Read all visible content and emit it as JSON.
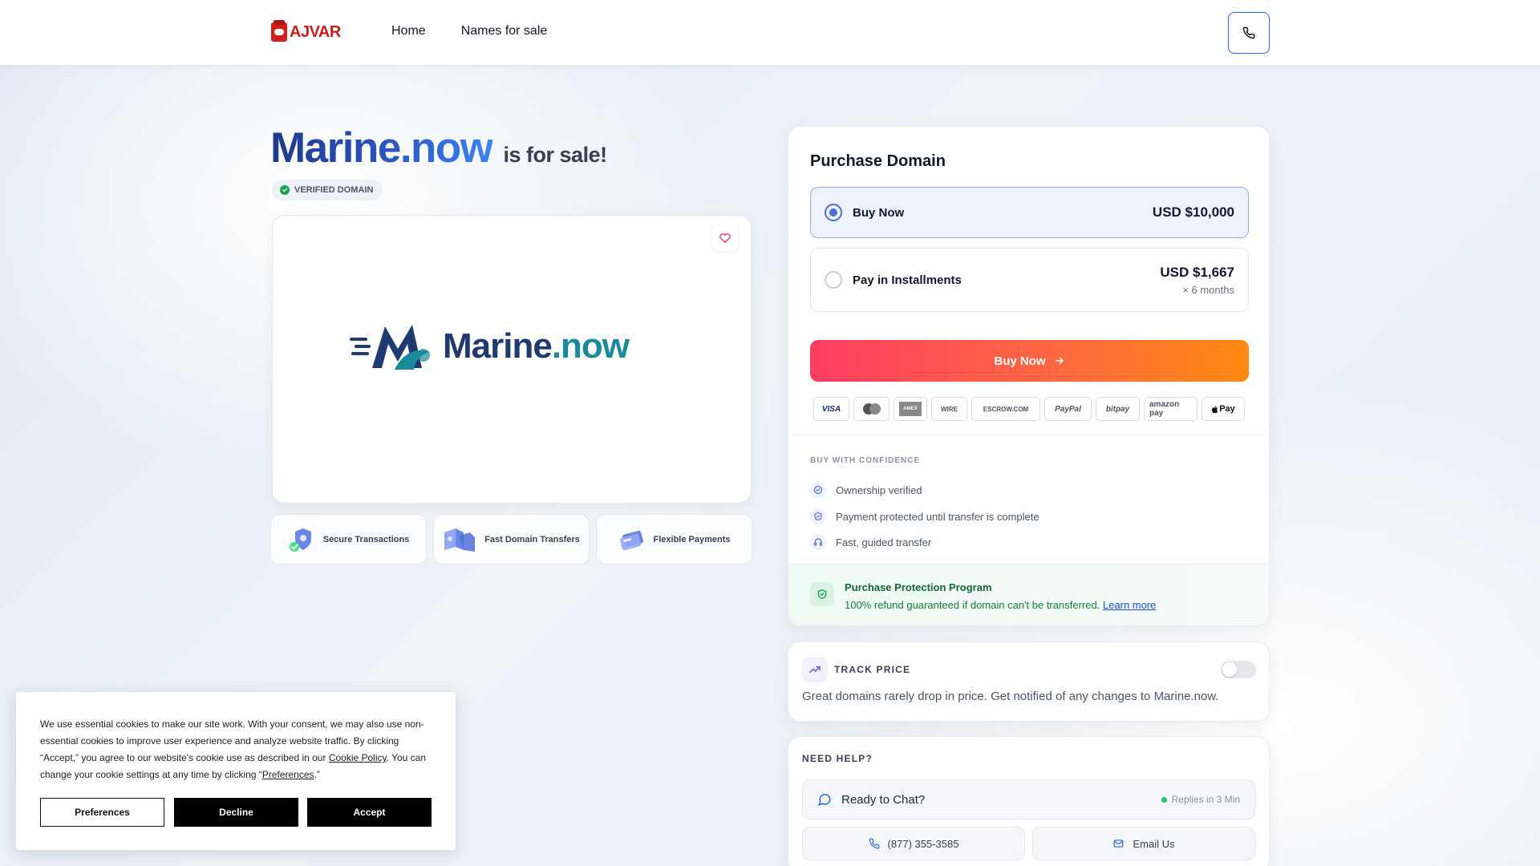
{
  "header": {
    "logo_text": "AJVAR",
    "nav": [
      "Home",
      "Names for sale"
    ]
  },
  "hero": {
    "domain_base": "Marine",
    "domain_tld": ".now",
    "for_sale": "is for sale!",
    "verified": "VERIFIED DOMAIN",
    "brand_main": "Marine",
    "brand_tld": ".now"
  },
  "features": [
    "Secure Transactions",
    "Fast Domain Transfers",
    "Flexible Payments"
  ],
  "purchase": {
    "title": "Purchase Domain",
    "buy_now_label": "Buy Now",
    "buy_now_price": "USD $10,000",
    "installments_label": "Pay in Installments",
    "installments_price": "USD $1,667",
    "installments_term": "× 6 months",
    "buy_button": "Buy Now",
    "payment_methods": [
      "VISA",
      "mastercard",
      "AMEX",
      "WIRE",
      "ESCROW.COM",
      "PayPal",
      "bitpay",
      "amazon pay",
      "Pay"
    ],
    "confidence_title": "BUY WITH CONFIDENCE",
    "confidence_items": [
      "Ownership verified",
      "Payment protected until transfer is complete",
      "Fast, guided transfer"
    ],
    "protection_title": "Purchase Protection Program",
    "protection_text": "100% refund guaranteed if domain can't be transferred.",
    "protection_link": "Learn more"
  },
  "track": {
    "title": "TRACK PRICE",
    "text": "Great domains rarely drop in price. Get notified of any changes to Marine.now.",
    "enabled": false
  },
  "help": {
    "title": "NEED HELP?",
    "chat_label": "Ready to Chat?",
    "reply_time": "Replies in 3 Min",
    "phone": "(877) 355-3585",
    "email_label": "Email Us"
  },
  "cookie": {
    "text_1": "We use essential cookies to make our site work. With your consent, we may also use non-essential cookies to improve user experience and analyze website traffic. By clicking “Accept,” you agree to our website's cookie use as described in our ",
    "policy_link": "Cookie Policy",
    "text_2": ". You can change your cookie settings at any time by clicking “",
    "pref_link": "Preferences",
    "text_3": ".”",
    "preferences": "Preferences",
    "decline": "Decline",
    "accept": "Accept"
  },
  "colors": {
    "accent": "#2563eb",
    "buy_gradient_start": "#ff3d63",
    "buy_gradient_end": "#ff8a10",
    "success": "#16a34a"
  }
}
